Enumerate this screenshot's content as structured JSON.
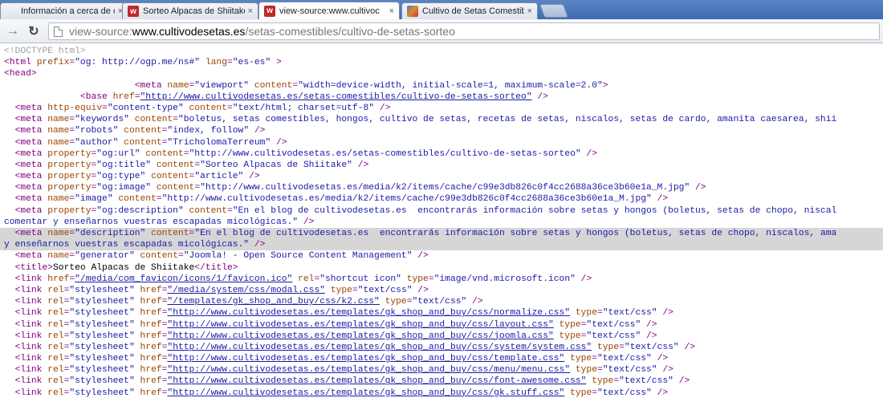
{
  "browser": {
    "tabs": [
      {
        "title": "Información a cerca de co",
        "favicon": "blank-page-icon",
        "active": false
      },
      {
        "title": "Sorteo Alpacas de Shiitake",
        "favicon": "w-logo-icon",
        "active": false
      },
      {
        "title": "view-source:www.cultivoc",
        "favicon": "w-logo-icon",
        "active": true
      },
      {
        "title": "Cultivo de Setas Comestib",
        "favicon": "colorful-logo-icon",
        "active": false
      }
    ],
    "close_glyph": "×",
    "favicon_letter": "w",
    "address": {
      "scheme": "view-source:",
      "host": "www.cultivodesetas.es",
      "path": "/setas-comestibles/cultivo-de-setas-sorteo"
    }
  },
  "source_lines": [
    {
      "parts": [
        [
          "c",
          "<!DOCTYPE html>"
        ]
      ]
    },
    {
      "parts": [
        [
          "t",
          "<html "
        ],
        [
          "a",
          "prefix"
        ],
        [
          "t",
          "="
        ],
        [
          "v",
          "\"og: http://ogp.me/ns#\""
        ],
        [
          "t",
          " "
        ],
        [
          "a",
          "lang"
        ],
        [
          "t",
          "="
        ],
        [
          "v",
          "\"es-es\""
        ],
        [
          "t",
          " >"
        ]
      ]
    },
    {
      "parts": [
        [
          "t",
          "<head>"
        ]
      ]
    },
    {
      "parts": [
        [
          "k",
          "                        "
        ],
        [
          "t",
          "<meta "
        ],
        [
          "a",
          "name"
        ],
        [
          "t",
          "="
        ],
        [
          "v",
          "\"viewport\""
        ],
        [
          "t",
          " "
        ],
        [
          "a",
          "content"
        ],
        [
          "t",
          "="
        ],
        [
          "v",
          "\"width=device-width, initial-scale=1, maximum-scale=2.0\""
        ],
        [
          "t",
          ">"
        ]
      ]
    },
    {
      "parts": [
        [
          "k",
          "              "
        ],
        [
          "t",
          "<base "
        ],
        [
          "a",
          "href"
        ],
        [
          "t",
          "="
        ],
        [
          "u",
          "\"http://www.cultivodesetas.es/setas-comestibles/cultivo-de-setas-sorteo\""
        ],
        [
          "t",
          " />"
        ]
      ]
    },
    {
      "parts": [
        [
          "k",
          "  "
        ],
        [
          "t",
          "<meta "
        ],
        [
          "a",
          "http-equiv"
        ],
        [
          "t",
          "="
        ],
        [
          "v",
          "\"content-type\""
        ],
        [
          "t",
          " "
        ],
        [
          "a",
          "content"
        ],
        [
          "t",
          "="
        ],
        [
          "v",
          "\"text/html; charset=utf-8\""
        ],
        [
          "t",
          " />"
        ]
      ]
    },
    {
      "parts": [
        [
          "k",
          "  "
        ],
        [
          "t",
          "<meta "
        ],
        [
          "a",
          "name"
        ],
        [
          "t",
          "="
        ],
        [
          "v",
          "\"keywords\""
        ],
        [
          "t",
          " "
        ],
        [
          "a",
          "content"
        ],
        [
          "t",
          "="
        ],
        [
          "v",
          "\"boletus, setas comestibles, hongos, cultivo de setas, recetas de setas, niscalos, setas de cardo, amanita caesarea, shii"
        ]
      ]
    },
    {
      "parts": [
        [
          "k",
          "  "
        ],
        [
          "t",
          "<meta "
        ],
        [
          "a",
          "name"
        ],
        [
          "t",
          "="
        ],
        [
          "v",
          "\"robots\""
        ],
        [
          "t",
          " "
        ],
        [
          "a",
          "content"
        ],
        [
          "t",
          "="
        ],
        [
          "v",
          "\"index, follow\""
        ],
        [
          "t",
          " />"
        ]
      ]
    },
    {
      "parts": [
        [
          "k",
          "  "
        ],
        [
          "t",
          "<meta "
        ],
        [
          "a",
          "name"
        ],
        [
          "t",
          "="
        ],
        [
          "v",
          "\"author\""
        ],
        [
          "t",
          " "
        ],
        [
          "a",
          "content"
        ],
        [
          "t",
          "="
        ],
        [
          "v",
          "\"TricholomaTerreum\""
        ],
        [
          "t",
          " />"
        ]
      ]
    },
    {
      "parts": [
        [
          "k",
          "  "
        ],
        [
          "t",
          "<meta "
        ],
        [
          "a",
          "property"
        ],
        [
          "t",
          "="
        ],
        [
          "v",
          "\"og:url\""
        ],
        [
          "t",
          " "
        ],
        [
          "a",
          "content"
        ],
        [
          "t",
          "="
        ],
        [
          "v",
          "\"http://www.cultivodesetas.es/setas-comestibles/cultivo-de-setas-sorteo\""
        ],
        [
          "t",
          " />"
        ]
      ]
    },
    {
      "parts": [
        [
          "k",
          "  "
        ],
        [
          "t",
          "<meta "
        ],
        [
          "a",
          "property"
        ],
        [
          "t",
          "="
        ],
        [
          "v",
          "\"og:title\""
        ],
        [
          "t",
          " "
        ],
        [
          "a",
          "content"
        ],
        [
          "t",
          "="
        ],
        [
          "v",
          "\"Sorteo Alpacas de Shiitake\""
        ],
        [
          "t",
          " />"
        ]
      ]
    },
    {
      "parts": [
        [
          "k",
          "  "
        ],
        [
          "t",
          "<meta "
        ],
        [
          "a",
          "property"
        ],
        [
          "t",
          "="
        ],
        [
          "v",
          "\"og:type\""
        ],
        [
          "t",
          " "
        ],
        [
          "a",
          "content"
        ],
        [
          "t",
          "="
        ],
        [
          "v",
          "\"article\""
        ],
        [
          "t",
          " />"
        ]
      ]
    },
    {
      "parts": [
        [
          "k",
          "  "
        ],
        [
          "t",
          "<meta "
        ],
        [
          "a",
          "property"
        ],
        [
          "t",
          "="
        ],
        [
          "v",
          "\"og:image\""
        ],
        [
          "t",
          " "
        ],
        [
          "a",
          "content"
        ],
        [
          "t",
          "="
        ],
        [
          "v",
          "\"http://www.cultivodesetas.es/media/k2/items/cache/c99e3db826c0f4cc2688a36ce3b60e1a_M.jpg\""
        ],
        [
          "t",
          " />"
        ]
      ]
    },
    {
      "parts": [
        [
          "k",
          "  "
        ],
        [
          "t",
          "<meta "
        ],
        [
          "a",
          "name"
        ],
        [
          "t",
          "="
        ],
        [
          "v",
          "\"image\""
        ],
        [
          "t",
          " "
        ],
        [
          "a",
          "content"
        ],
        [
          "t",
          "="
        ],
        [
          "v",
          "\"http://www.cultivodesetas.es/media/k2/items/cache/c99e3db826c0f4cc2688a36ce3b60e1a_M.jpg\""
        ],
        [
          "t",
          " />"
        ]
      ]
    },
    {
      "parts": [
        [
          "k",
          "  "
        ],
        [
          "t",
          "<meta "
        ],
        [
          "a",
          "property"
        ],
        [
          "t",
          "="
        ],
        [
          "v",
          "\"og:description\""
        ],
        [
          "t",
          " "
        ],
        [
          "a",
          "content"
        ],
        [
          "t",
          "="
        ],
        [
          "v",
          "\"En el blog de cultivodesetas.es  encontrarás información sobre setas y hongos (boletus, setas de chopo, niscal"
        ]
      ]
    },
    {
      "parts": [
        [
          "v",
          "comentar y enseñarnos vuestras escapadas micológicas.\""
        ],
        [
          "t",
          " />"
        ]
      ]
    },
    {
      "hl": true,
      "parts": [
        [
          "k",
          "  "
        ],
        [
          "t",
          "<meta "
        ],
        [
          "a",
          "name"
        ],
        [
          "t",
          "="
        ],
        [
          "v",
          "\"description\""
        ],
        [
          "t",
          " "
        ],
        [
          "a",
          "content"
        ],
        [
          "t",
          "="
        ],
        [
          "v",
          "\"En el blog de cultivodesetas.es  encontrarás información sobre setas y hongos (boletus, setas de chopo, niscalos, ama"
        ]
      ]
    },
    {
      "hl": true,
      "parts": [
        [
          "v",
          "y enseñarnos vuestras escapadas micológicas.\""
        ],
        [
          "t",
          " />"
        ]
      ]
    },
    {
      "parts": [
        [
          "k",
          "  "
        ],
        [
          "t",
          "<meta "
        ],
        [
          "a",
          "name"
        ],
        [
          "t",
          "="
        ],
        [
          "v",
          "\"generator\""
        ],
        [
          "t",
          " "
        ],
        [
          "a",
          "content"
        ],
        [
          "t",
          "="
        ],
        [
          "v",
          "\"Joomla! - Open Source Content Management\""
        ],
        [
          "t",
          " />"
        ]
      ]
    },
    {
      "parts": [
        [
          "k",
          "  "
        ],
        [
          "t",
          "<title>"
        ],
        [
          "k",
          "Sorteo Alpacas de Shiitake"
        ],
        [
          "t",
          "</title>"
        ]
      ]
    },
    {
      "parts": [
        [
          "k",
          "  "
        ],
        [
          "t",
          "<link "
        ],
        [
          "a",
          "href"
        ],
        [
          "t",
          "="
        ],
        [
          "u",
          "\"/media/com_favicon/icons/1/favicon.ico\""
        ],
        [
          "t",
          " "
        ],
        [
          "a",
          "rel"
        ],
        [
          "t",
          "="
        ],
        [
          "v",
          "\"shortcut icon\""
        ],
        [
          "t",
          " "
        ],
        [
          "a",
          "type"
        ],
        [
          "t",
          "="
        ],
        [
          "v",
          "\"image/vnd.microsoft.icon\""
        ],
        [
          "t",
          " />"
        ]
      ]
    },
    {
      "parts": [
        [
          "k",
          "  "
        ],
        [
          "t",
          "<link "
        ],
        [
          "a",
          "rel"
        ],
        [
          "t",
          "="
        ],
        [
          "v",
          "\"stylesheet\""
        ],
        [
          "t",
          " "
        ],
        [
          "a",
          "href"
        ],
        [
          "t",
          "="
        ],
        [
          "u",
          "\"/media/system/css/modal.css\""
        ],
        [
          "t",
          " "
        ],
        [
          "a",
          "type"
        ],
        [
          "t",
          "="
        ],
        [
          "v",
          "\"text/css\""
        ],
        [
          "t",
          " />"
        ]
      ]
    },
    {
      "parts": [
        [
          "k",
          "  "
        ],
        [
          "t",
          "<link "
        ],
        [
          "a",
          "rel"
        ],
        [
          "t",
          "="
        ],
        [
          "v",
          "\"stylesheet\""
        ],
        [
          "t",
          " "
        ],
        [
          "a",
          "href"
        ],
        [
          "t",
          "="
        ],
        [
          "u",
          "\"/templates/gk_shop_and_buy/css/k2.css\""
        ],
        [
          "t",
          " "
        ],
        [
          "a",
          "type"
        ],
        [
          "t",
          "="
        ],
        [
          "v",
          "\"text/css\""
        ],
        [
          "t",
          " />"
        ]
      ]
    },
    {
      "parts": [
        [
          "k",
          "  "
        ],
        [
          "t",
          "<link "
        ],
        [
          "a",
          "rel"
        ],
        [
          "t",
          "="
        ],
        [
          "v",
          "\"stylesheet\""
        ],
        [
          "t",
          " "
        ],
        [
          "a",
          "href"
        ],
        [
          "t",
          "="
        ],
        [
          "u",
          "\"http://www.cultivodesetas.es/templates/gk_shop_and_buy/css/normalize.css\""
        ],
        [
          "t",
          " "
        ],
        [
          "a",
          "type"
        ],
        [
          "t",
          "="
        ],
        [
          "v",
          "\"text/css\""
        ],
        [
          "t",
          " />"
        ]
      ]
    },
    {
      "parts": [
        [
          "k",
          "  "
        ],
        [
          "t",
          "<link "
        ],
        [
          "a",
          "rel"
        ],
        [
          "t",
          "="
        ],
        [
          "v",
          "\"stylesheet\""
        ],
        [
          "t",
          " "
        ],
        [
          "a",
          "href"
        ],
        [
          "t",
          "="
        ],
        [
          "u",
          "\"http://www.cultivodesetas.es/templates/gk_shop_and_buy/css/layout.css\""
        ],
        [
          "t",
          " "
        ],
        [
          "a",
          "type"
        ],
        [
          "t",
          "="
        ],
        [
          "v",
          "\"text/css\""
        ],
        [
          "t",
          " />"
        ]
      ]
    },
    {
      "parts": [
        [
          "k",
          "  "
        ],
        [
          "t",
          "<link "
        ],
        [
          "a",
          "rel"
        ],
        [
          "t",
          "="
        ],
        [
          "v",
          "\"stylesheet\""
        ],
        [
          "t",
          " "
        ],
        [
          "a",
          "href"
        ],
        [
          "t",
          "="
        ],
        [
          "u",
          "\"http://www.cultivodesetas.es/templates/gk_shop_and_buy/css/joomla.css\""
        ],
        [
          "t",
          " "
        ],
        [
          "a",
          "type"
        ],
        [
          "t",
          "="
        ],
        [
          "v",
          "\"text/css\""
        ],
        [
          "t",
          " />"
        ]
      ]
    },
    {
      "parts": [
        [
          "k",
          "  "
        ],
        [
          "t",
          "<link "
        ],
        [
          "a",
          "rel"
        ],
        [
          "t",
          "="
        ],
        [
          "v",
          "\"stylesheet\""
        ],
        [
          "t",
          " "
        ],
        [
          "a",
          "href"
        ],
        [
          "t",
          "="
        ],
        [
          "u",
          "\"http://www.cultivodesetas.es/templates/gk_shop_and_buy/css/system/system.css\""
        ],
        [
          "t",
          " "
        ],
        [
          "a",
          "type"
        ],
        [
          "t",
          "="
        ],
        [
          "v",
          "\"text/css\""
        ],
        [
          "t",
          " />"
        ]
      ]
    },
    {
      "parts": [
        [
          "k",
          "  "
        ],
        [
          "t",
          "<link "
        ],
        [
          "a",
          "rel"
        ],
        [
          "t",
          "="
        ],
        [
          "v",
          "\"stylesheet\""
        ],
        [
          "t",
          " "
        ],
        [
          "a",
          "href"
        ],
        [
          "t",
          "="
        ],
        [
          "u",
          "\"http://www.cultivodesetas.es/templates/gk_shop_and_buy/css/template.css\""
        ],
        [
          "t",
          " "
        ],
        [
          "a",
          "type"
        ],
        [
          "t",
          "="
        ],
        [
          "v",
          "\"text/css\""
        ],
        [
          "t",
          " />"
        ]
      ]
    },
    {
      "parts": [
        [
          "k",
          "  "
        ],
        [
          "t",
          "<link "
        ],
        [
          "a",
          "rel"
        ],
        [
          "t",
          "="
        ],
        [
          "v",
          "\"stylesheet\""
        ],
        [
          "t",
          " "
        ],
        [
          "a",
          "href"
        ],
        [
          "t",
          "="
        ],
        [
          "u",
          "\"http://www.cultivodesetas.es/templates/gk_shop_and_buy/css/menu/menu.css\""
        ],
        [
          "t",
          " "
        ],
        [
          "a",
          "type"
        ],
        [
          "t",
          "="
        ],
        [
          "v",
          "\"text/css\""
        ],
        [
          "t",
          " />"
        ]
      ]
    },
    {
      "parts": [
        [
          "k",
          "  "
        ],
        [
          "t",
          "<link "
        ],
        [
          "a",
          "rel"
        ],
        [
          "t",
          "="
        ],
        [
          "v",
          "\"stylesheet\""
        ],
        [
          "t",
          " "
        ],
        [
          "a",
          "href"
        ],
        [
          "t",
          "="
        ],
        [
          "u",
          "\"http://www.cultivodesetas.es/templates/gk_shop_and_buy/css/font-awesome.css\""
        ],
        [
          "t",
          " "
        ],
        [
          "a",
          "type"
        ],
        [
          "t",
          "="
        ],
        [
          "v",
          "\"text/css\""
        ],
        [
          "t",
          " />"
        ]
      ]
    },
    {
      "parts": [
        [
          "k",
          "  "
        ],
        [
          "t",
          "<link "
        ],
        [
          "a",
          "rel"
        ],
        [
          "t",
          "="
        ],
        [
          "v",
          "\"stylesheet\""
        ],
        [
          "t",
          " "
        ],
        [
          "a",
          "href"
        ],
        [
          "t",
          "="
        ],
        [
          "u",
          "\"http://www.cultivodesetas.es/templates/gk_shop_and_buy/css/gk.stuff.css\""
        ],
        [
          "t",
          " "
        ],
        [
          "a",
          "type"
        ],
        [
          "t",
          "="
        ],
        [
          "v",
          "\"text/css\""
        ],
        [
          "t",
          " />"
        ]
      ]
    }
  ]
}
